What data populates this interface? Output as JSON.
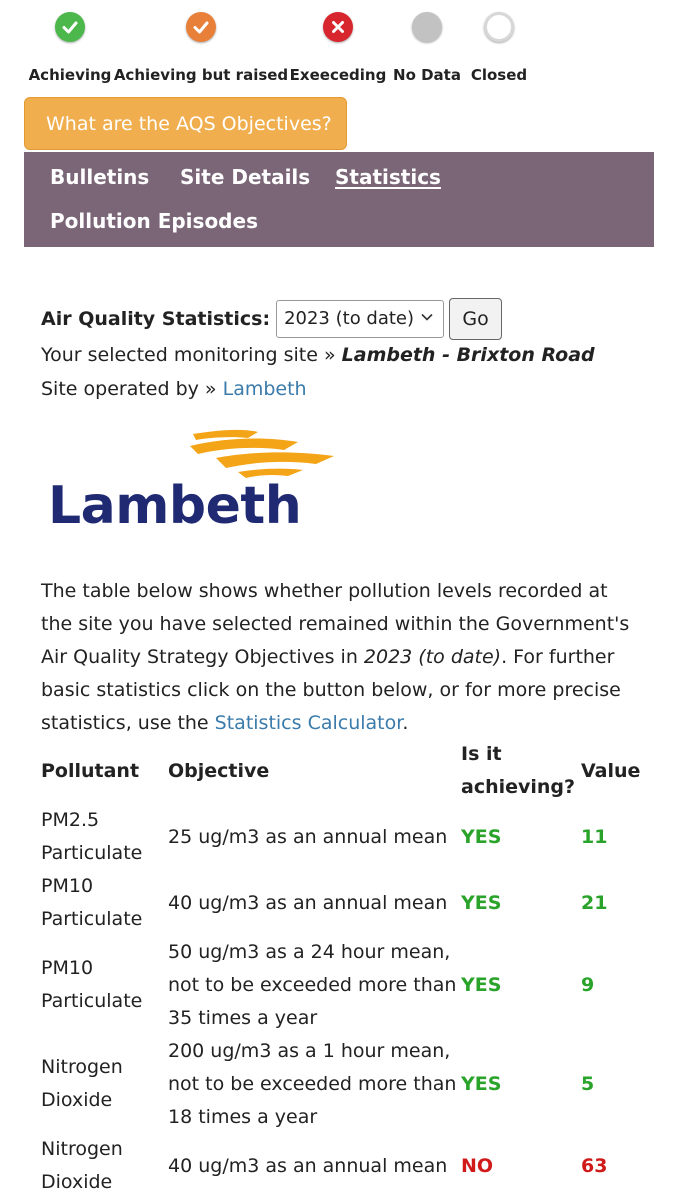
{
  "legend": [
    {
      "label": "Achieving",
      "icon": "check-icon",
      "color": "#4cb84c"
    },
    {
      "label": "Achieving but raised",
      "icon": "check-icon",
      "color": "#e8803a"
    },
    {
      "label": "Exeeceding",
      "icon": "cross-icon",
      "color": "#d8262f"
    },
    {
      "label": "No Data",
      "icon": "grey-dot-icon",
      "color": "#c2c2c2"
    },
    {
      "label": "Closed",
      "icon": "ring-icon",
      "color": "#ffffff"
    }
  ],
  "aqs_button": "What are the AQS Objectives?",
  "nav": {
    "bulletins": "Bulletins",
    "site_details": "Site Details",
    "statistics": "Statistics",
    "pollution_episodes": "Pollution Episodes"
  },
  "stats": {
    "label": "Air Quality Statistics:",
    "selected_year": "2023 (to date)",
    "go": "Go"
  },
  "site": {
    "selected_prefix": "Your selected monitoring site »",
    "selected_name": "Lambeth - Brixton Road",
    "operated_prefix": "Site operated by »",
    "operator": "Lambeth"
  },
  "logo_text": "Lambeth",
  "paragraph": {
    "part1": "The table below shows whether pollution levels recorded at the site you have selected remained within the Government's Air Quality Strategy Objectives in ",
    "year": "2023 (to date)",
    "part2": ". For further basic statistics click on the button below, or for more precise statistics, use the ",
    "link": "Statistics Calculator",
    "part3": "."
  },
  "table": {
    "headers": {
      "pollutant": "Pollutant",
      "objective": "Objective",
      "achieving_1": "Is it",
      "achieving_2": "achieving?",
      "value": "Value"
    },
    "rows": [
      {
        "pollutant": [
          "PM2.5",
          "Particulate"
        ],
        "objective": [
          "25 ug/m3 as an annual mean"
        ],
        "achieving": "YES",
        "value": "11"
      },
      {
        "pollutant": [
          "PM10",
          "Particulate"
        ],
        "objective": [
          "40 ug/m3 as an annual mean"
        ],
        "achieving": "YES",
        "value": "21"
      },
      {
        "pollutant": [
          "PM10",
          "Particulate"
        ],
        "objective": [
          "50 ug/m3 as a 24 hour mean,",
          "not to be exceeded more than",
          "35 times a year"
        ],
        "achieving": "YES",
        "value": "9"
      },
      {
        "pollutant": [
          "Nitrogen",
          "Dioxide"
        ],
        "objective": [
          "200 ug/m3 as a 1 hour mean,",
          "not to be exceeded more than",
          "18 times a year"
        ],
        "achieving": "YES",
        "value": "5"
      },
      {
        "pollutant": [
          "Nitrogen",
          "Dioxide"
        ],
        "objective": [
          "40 ug/m3 as an annual mean"
        ],
        "achieving": "NO",
        "value": "63"
      }
    ]
  }
}
